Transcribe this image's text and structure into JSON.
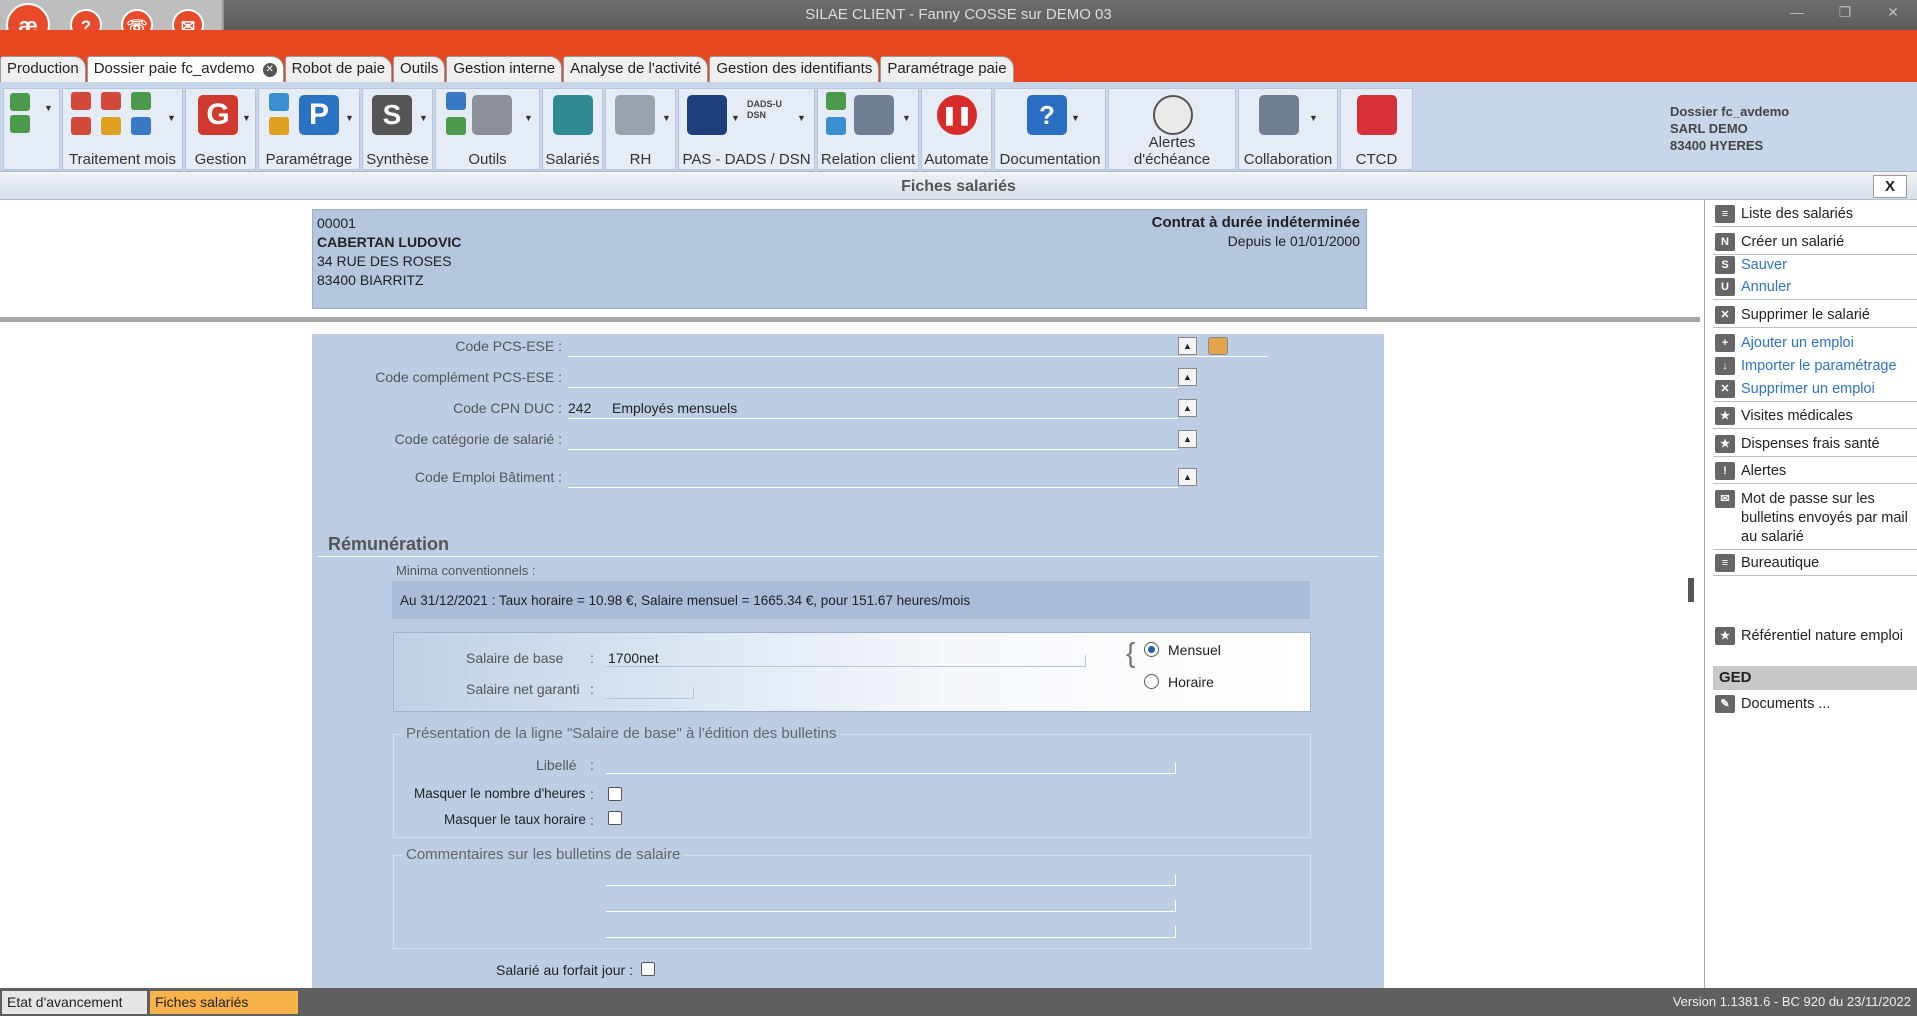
{
  "window": {
    "title": "SILAE CLIENT - Fanny COSSE sur DEMO 03",
    "logo_text": "æ",
    "quick": [
      "?",
      "☏",
      "✉"
    ],
    "controls": [
      "—",
      "❐",
      "✕"
    ]
  },
  "tabs": [
    {
      "label": "Production"
    },
    {
      "label": "Dossier paie fc_avdemo",
      "close": "✕"
    },
    {
      "label": "Robot de paie"
    },
    {
      "label": "Outils"
    },
    {
      "label": "Gestion interne"
    },
    {
      "label": "Analyse de l'activité"
    },
    {
      "label": "Gestion des identifiants"
    },
    {
      "label": "Paramétrage paie"
    }
  ],
  "ribbon": {
    "groups": [
      "",
      "Traitement mois",
      "Gestion",
      "Paramétrage",
      "Synthèse",
      "Outils",
      "Salariés",
      "RH",
      "PAS - DADS / DSN",
      "Relation client",
      "Automate",
      "Documentation",
      "Alertes d'échéance",
      "Collaboration",
      "CTCD"
    ],
    "dads_label": "DADS-U DSN"
  },
  "dossier": {
    "line1": "Dossier fc_avdemo",
    "line2": "SARL DEMO",
    "line3": "83400 HYERES"
  },
  "section_title": "Fiches salariés",
  "close_label": "X",
  "employee": {
    "code": "00001",
    "name": "CABERTAN LUDOVIC",
    "address1": "34 RUE DES ROSES",
    "address2": "83400 BIARRITZ",
    "contract": "Contrat à durée indéterminée",
    "since": "Depuis le 01/01/2000"
  },
  "codes": {
    "pcs_label": "Code PCS-ESE :",
    "pcs_comp_label": "Code complément PCS-ESE :",
    "cpn_label": "Code CPN DUC :",
    "cpn_code": "242",
    "cpn_value": "Employés mensuels",
    "cat_label": "Code catégorie de salarié :",
    "emploi_label": "Code Emploi Bâtiment :"
  },
  "remuneration": {
    "title": "Rémunération",
    "minima_label": "Minima conventionnels :",
    "minima_text": "Au 31/12/2021 : Taux horaire = 10.98 €, Salaire mensuel = 1665.34 €, pour 151.67 heures/mois",
    "base_label": "Salaire de base",
    "base_value": "1700net",
    "net_label": "Salaire net garanti",
    "colon": ":",
    "mensuel": "Mensuel",
    "horaire": "Horaire",
    "selected": "Mensuel"
  },
  "presentation": {
    "legend": "Présentation de la ligne \"Salaire de base\" à l'édition des bulletins",
    "libelle_label": "Libellé",
    "masquer_heures": "Masquer le nombre d'heures",
    "masquer_taux": "Masquer le taux horaire"
  },
  "commentaires": {
    "legend": "Commentaires sur les bulletins de salaire"
  },
  "forfait_label": "Salarié au forfait jour :",
  "right_panel": {
    "items": [
      {
        "label": "Liste des salariés",
        "icon": "≡"
      },
      {
        "label": "Créer un salarié",
        "icon": "N"
      },
      {
        "label": "Sauver",
        "icon": "S"
      },
      {
        "label": "Annuler",
        "icon": "U"
      },
      {
        "label": "Supprimer le salarié",
        "icon": "✕"
      },
      {
        "label": "Ajouter un emploi",
        "icon": "+"
      },
      {
        "label": "Importer le paramétrage",
        "icon": "↓"
      },
      {
        "label": "Supprimer un emploi",
        "icon": "✕"
      },
      {
        "label": "Visites médicales",
        "icon": "★"
      },
      {
        "label": "Dispenses frais santé",
        "icon": "★"
      },
      {
        "label": "Alertes",
        "icon": "!"
      },
      {
        "label": "Mot de passe sur les bulletins envoyés par mail au salarié",
        "icon": "✉"
      },
      {
        "label": "Bureautique",
        "icon": "≡"
      },
      {
        "label": "Référentiel nature emploi",
        "icon": "★"
      },
      {
        "label": "Documents ...",
        "icon": "✎"
      }
    ],
    "ged": "GED"
  },
  "statusbar": {
    "tab1": "Etat d'avancement",
    "tab2": "Fiches salariés",
    "version": "Version 1.1381.6 - BC 920 du 23/11/2022"
  }
}
